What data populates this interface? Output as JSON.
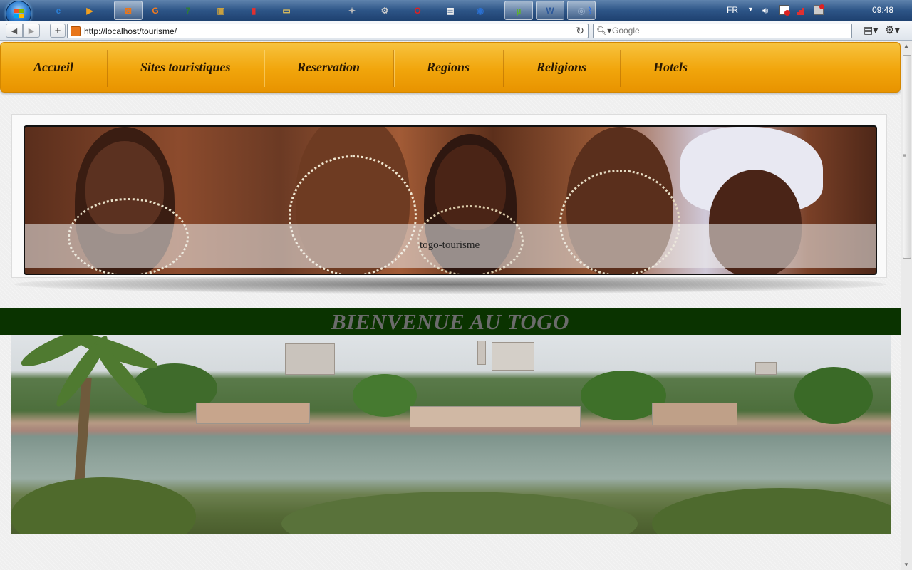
{
  "taskbar": {
    "start_icon": "windows-start-orb",
    "pinned_icons": [
      {
        "name": "ie-icon",
        "glyph": "e",
        "color": "#2b7fd6"
      },
      {
        "name": "media-player-icon",
        "glyph": "▶",
        "color": "#f0a020"
      },
      {
        "name": "xampp-icon",
        "glyph": "⊠",
        "color": "#e8761b"
      },
      {
        "name": "app-g-icon",
        "glyph": "G",
        "color": "#f07a20"
      },
      {
        "name": "seven-zip-icon",
        "glyph": "7",
        "color": "#2e7d32"
      },
      {
        "name": "slideshow-icon",
        "glyph": "▣",
        "color": "#c8a040"
      },
      {
        "name": "chart-tool-icon",
        "glyph": "▮",
        "color": "#e03030"
      },
      {
        "name": "folder-icon",
        "glyph": "▭",
        "color": "#e6c25a"
      },
      {
        "name": "tools-icon",
        "glyph": "✦",
        "color": "#bbbbbb"
      },
      {
        "name": "settings-icon",
        "glyph": "⚙",
        "color": "#cccccc"
      },
      {
        "name": "opera-icon",
        "glyph": "O",
        "color": "#e02020"
      },
      {
        "name": "notepad-icon",
        "glyph": "▤",
        "color": "#eeeeee"
      },
      {
        "name": "firefox-icon",
        "glyph": "◉",
        "color": "#2a6fd0"
      },
      {
        "name": "utorrent-icon",
        "glyph": "µ",
        "color": "#5cb030"
      },
      {
        "name": "word-icon",
        "glyph": "W",
        "color": "#2b579a"
      },
      {
        "name": "browser-app-icon",
        "glyph": "◎",
        "color": "#9ab0cc"
      },
      {
        "name": "bluetooth-icon",
        "glyph": "ᛒ",
        "color": "#3070e0"
      }
    ],
    "language": "FR",
    "clock": "09:48"
  },
  "browser": {
    "url": "http://localhost/tourisme/",
    "search_placeholder": "Google"
  },
  "nav": {
    "items": [
      {
        "label": "Accueil"
      },
      {
        "label": "Sites touristiques"
      },
      {
        "label": "Reservation"
      },
      {
        "label": "Regions"
      },
      {
        "label": "Religions"
      },
      {
        "label": "Hotels"
      }
    ]
  },
  "banner": {
    "caption": "togo-tourisme"
  },
  "welcome": {
    "title": "BIENVENUE AU TOGO"
  },
  "colors": {
    "nav_bar": "#f1a50b",
    "welcome_band": "#0a3300",
    "welcome_text": "#6b6b6b"
  }
}
